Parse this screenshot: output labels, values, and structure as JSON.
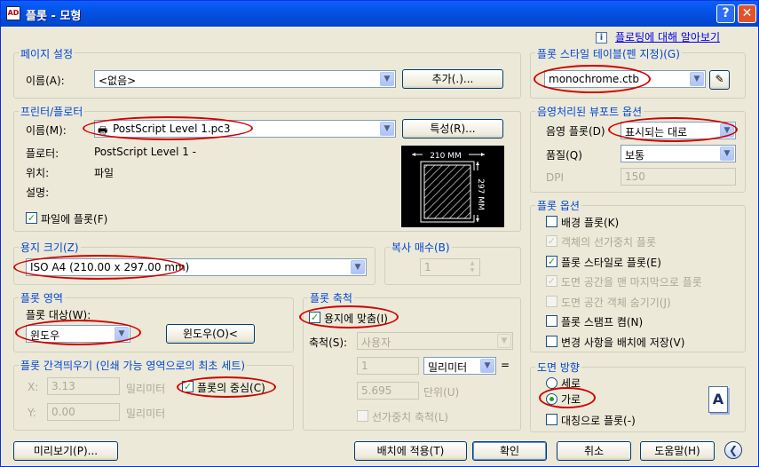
{
  "window": {
    "title": "플롯 - 모형",
    "app_icon": "AutoCAD"
  },
  "help_link": "플로팅에 대해 알아보기",
  "page_setup": {
    "group": "페이지 설정",
    "name_label": "이름(A):",
    "name_value": "<없음>",
    "add_button": "추가(.)..."
  },
  "printer": {
    "group": "프린터/플로터",
    "name_label": "이름(M):",
    "name_value": "PostScript Level 1.pc3",
    "properties_button": "특성(R)...",
    "plotter_label": "플로터:",
    "plotter_value": "PostScript Level 1 -",
    "location_label": "위치:",
    "location_value": "파일",
    "description_label": "설명:",
    "plot_to_file": "파일에 플롯(F)",
    "preview": {
      "width": "210 MM",
      "height": "297 MM"
    }
  },
  "paper_size": {
    "group": "용지 크기(Z)",
    "value": "ISO A4 (210.00 x 297.00 mm)"
  },
  "copies": {
    "group": "복사 매수(B)",
    "value": "1"
  },
  "plot_area": {
    "group": "플롯 영역",
    "what_label": "플롯 대상(W):",
    "what_value": "윈도우",
    "window_button": "윈도우(O)<"
  },
  "plot_offset": {
    "group": "플롯 간격띄우기 (인쇄 가능 영역으로의 최초 세트)",
    "x_label": "X:",
    "x_value": "3.13",
    "y_label": "Y:",
    "y_value": "0.00",
    "unit": "밀리미터",
    "center": "플롯의 중심(C)"
  },
  "plot_scale": {
    "group": "플롯 축척",
    "fit": "용지에 맞춤(I)",
    "scale_label": "축척(S):",
    "scale_value": "사용자",
    "v1": "1",
    "unit": "밀리미터",
    "eq": "=",
    "v2": "5.695",
    "unit_label": "단위(U)",
    "lineweight": "선가중치 축척(L)"
  },
  "style_table": {
    "group": "플롯 스타일 테이블(펜 지정)(G)",
    "value": "monochrome.ctb"
  },
  "shaded": {
    "group": "음영처리된 뷰포트 옵션",
    "shade_label": "음영 플롯(D)",
    "shade_value": "표시되는 대로",
    "quality_label": "품질(Q)",
    "quality_value": "보통",
    "dpi_label": "DPI",
    "dpi_value": "150"
  },
  "plot_options": {
    "group": "플롯 옵션",
    "items": [
      {
        "label": "배경 플롯(K)",
        "checked": false,
        "disabled": false
      },
      {
        "label": "객체의 선가중치 플롯",
        "checked": true,
        "disabled": true
      },
      {
        "label": "플롯 스타일로 플롯(E)",
        "checked": true,
        "disabled": false
      },
      {
        "label": "도면 공간을 맨 마지막으로 플롯",
        "checked": true,
        "disabled": true
      },
      {
        "label": "도면 공간 객체 숨기기(J)",
        "checked": false,
        "disabled": true
      },
      {
        "label": "플롯 스탬프 켬(N)",
        "checked": false,
        "disabled": false
      },
      {
        "label": "변경 사항을 배치에 저장(V)",
        "checked": false,
        "disabled": false
      }
    ]
  },
  "orientation": {
    "group": "도면 방향",
    "portrait": "세로",
    "landscape": "가로",
    "upside_down": "대칭으로 플롯(-)",
    "preview_letter": "A"
  },
  "footer": {
    "preview": "미리보기(P)...",
    "apply": "배치에 적용(T)",
    "ok": "확인",
    "cancel": "취소",
    "help": "도움말(H)"
  },
  "colors": {
    "highlight": "#d00000",
    "group_label": "#0046d5",
    "title_bar": "#0553e6"
  }
}
